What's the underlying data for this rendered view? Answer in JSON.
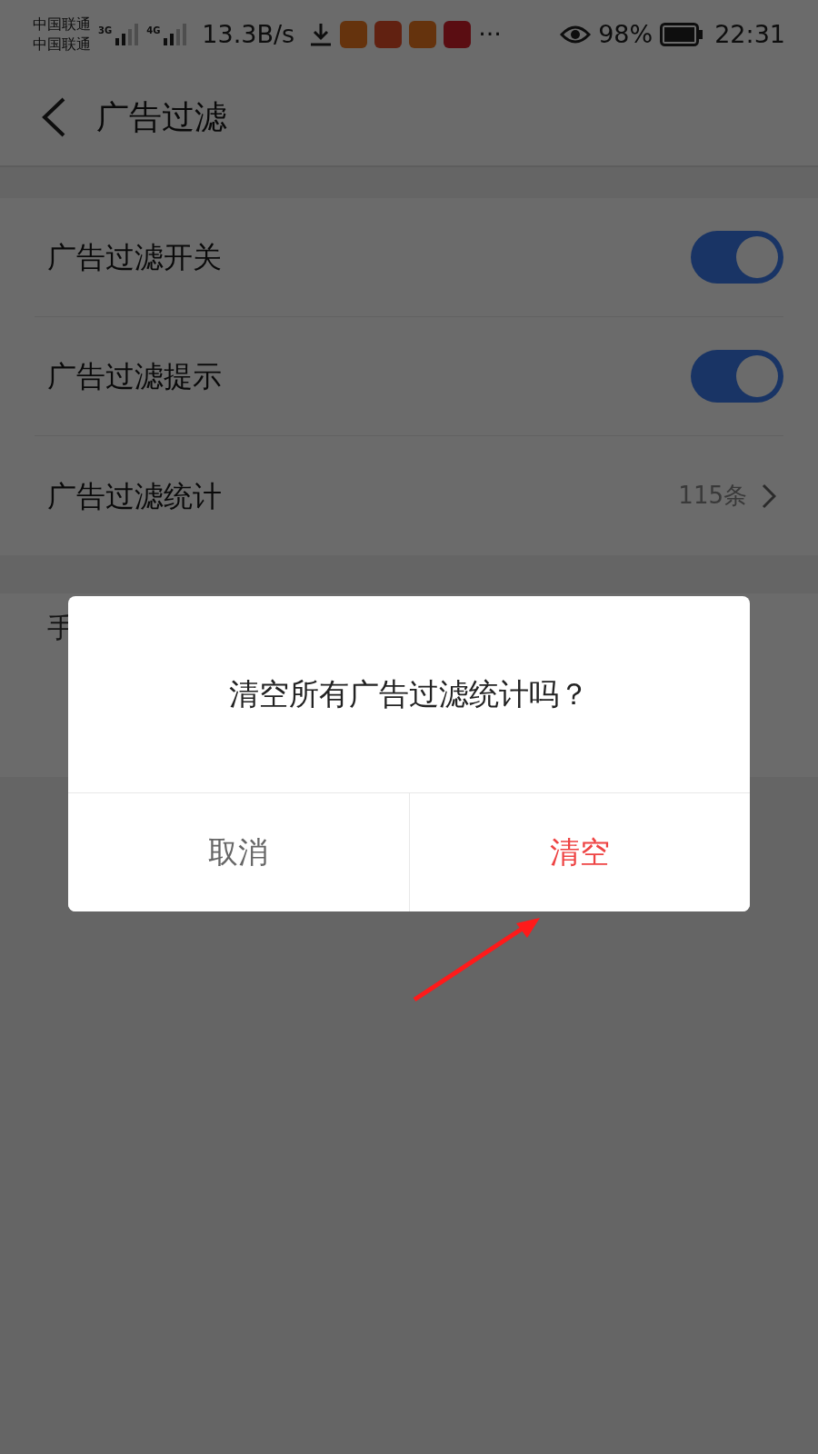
{
  "status_bar": {
    "carriers": [
      "中国联通",
      "中国联通"
    ],
    "network_labels": [
      "3G",
      "4G"
    ],
    "speed": "13.3B/s",
    "more": "···",
    "battery": "98%",
    "time": "22:31"
  },
  "header": {
    "title": "广告过滤"
  },
  "settings": [
    {
      "kind": "toggle",
      "label": "广告过滤开关",
      "on": true
    },
    {
      "kind": "toggle",
      "label": "广告过滤提示",
      "on": true
    },
    {
      "kind": "link",
      "label": "广告过滤统计",
      "value": "115条"
    }
  ],
  "partial_row": {
    "label": "手"
  },
  "dialog": {
    "message": "清空所有广告过滤统计吗？",
    "buttons": [
      {
        "label": "取消",
        "kind": "cancel"
      },
      {
        "label": "清空",
        "kind": "destructive"
      }
    ]
  }
}
